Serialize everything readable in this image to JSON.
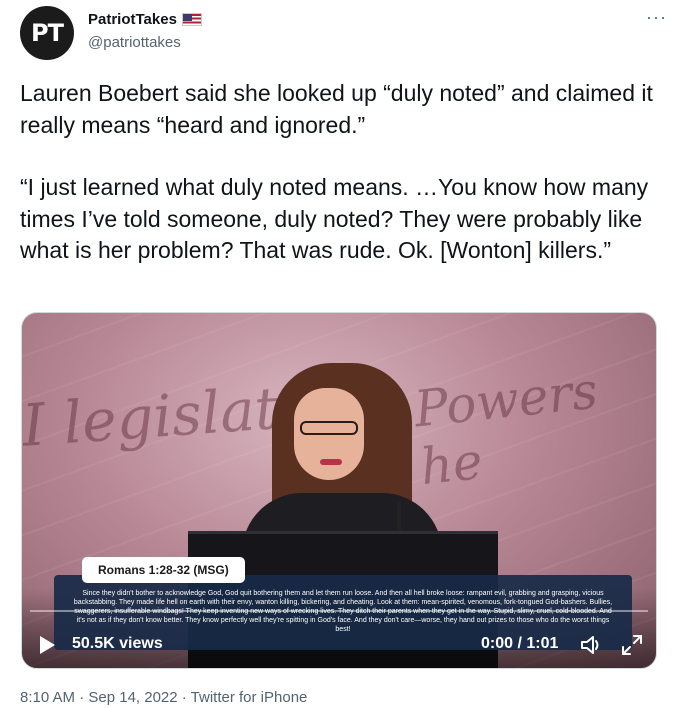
{
  "author": {
    "avatar_text": "PT",
    "display_name": "PatriotTakes",
    "handle": "@patriottakes",
    "flag_icon": "us-flag-icon"
  },
  "tweet": {
    "paragraph_1": "Lauren Boebert said she looked up “duly noted” and claimed it really means “heard and ignored.”",
    "paragraph_2": "“I just learned what duly noted means. …You know how many times I’ve told someone, duly noted? They were probably like what is her problem? That was rude. Ok. [Wonton] killers.”"
  },
  "video": {
    "caption_title": "Romans 1:28-32 (MSG)",
    "caption_text": "Since they didn't bother to acknowledge God, God quit bothering them and let them run loose. And then all hell broke loose: rampant evil, grabbing and grasping, vicious backstabbing. They made life hell on earth with their envy, wanton killing, bickering, and cheating. Look at them: mean-spirited, venomous, fork-tongued God-bashers. Bullies, swaggerers, insufferable windbags! They keep inventing new ways of wrecking lives. They ditch their parents when they get in the way. Stupid, slimy, cruel, cold-blooded. And it's not as if they don't know better. They know perfectly well they're spitting in God's face. And they don't care—worse, they hand out prizes to those who do the worst things best!",
    "views": "50.5K views",
    "time": "0:00 / 1:01",
    "progress_fraction": 0.0,
    "background_script_1": "I legislat",
    "background_script_2": "Powers he"
  },
  "meta": {
    "timestamp": "8:10 AM · Sep 14, 2022 · Twitter for iPhone"
  },
  "colors": {
    "text": "#0f1419",
    "secondary": "#536471",
    "caption_bg": "#182a48"
  }
}
